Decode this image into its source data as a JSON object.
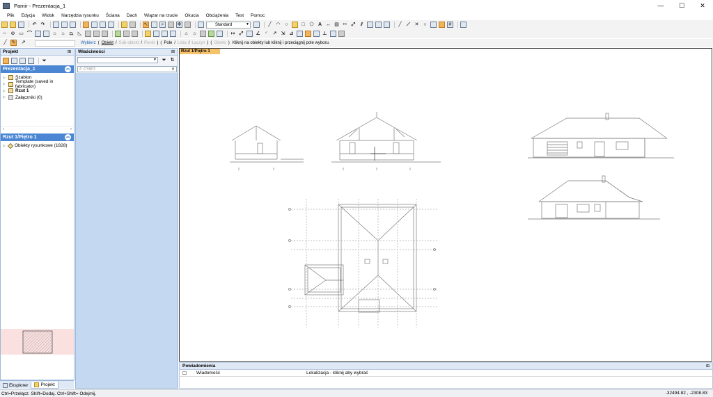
{
  "window": {
    "title": "Pamir - Prezentacja_1",
    "min": "—",
    "max": "☐",
    "close": "✕"
  },
  "menu": [
    "Plik",
    "Edycja",
    "Widok",
    "Narzędzia rysunku",
    "Ściana",
    "Dach",
    "Wiązar na rzucie",
    "Okucia",
    "Obciążenia",
    "Test",
    "Pomoc"
  ],
  "toolbar": {
    "style_combo": "Standard"
  },
  "selection_bar": {
    "cmd_select": "Wybierz",
    "opt_object": "Obiekt",
    "opt_sub_object": "Sub-obiekt",
    "opt_point": "Punkt",
    "opt_field": "Pole",
    "opt_line": "Linia",
    "opt_edge": "Łączyn",
    "opt_extra": "Obiekt",
    "hint": "Kliknij na obiekty lub kliknij i przeciągnij pole wyboru."
  },
  "project_panel": {
    "header": "Projekt",
    "section_title": "Prezentacja_1",
    "items": [
      {
        "label": "Szablon",
        "bold": false
      },
      {
        "label": "Template (saved in fabricator)",
        "bold": false
      },
      {
        "label": "Rzut 1",
        "bold": true
      },
      {
        "label": "Załączniki (0)",
        "bold": false
      }
    ],
    "floor_title": "Rzut 1/Piętro 1",
    "floor_items": [
      {
        "label": "Obiekty rysunkowe (1828)"
      }
    ]
  },
  "properties_panel": {
    "header": "Właściwości",
    "search_placeholder": "Znajdź"
  },
  "canvas": {
    "tab_label": "Rzut 1/Piętro 1"
  },
  "notifications": {
    "header": "Powiadomienia",
    "col_message": "Wiadomość",
    "col_location": "Lokalizacja - kliknij aby wybrać"
  },
  "bottom_tabs": {
    "explorer": "Eksplorer",
    "project": "Projekt"
  },
  "status": {
    "hint": "Ctrl=Przełącz. Shift=Dodaj. Ctrl+Shift= Odejmij.",
    "coords": "-32494.82 , -2308.83"
  },
  "colors": {
    "accent_blue": "#4a86d3",
    "panel_blue": "#dfe8f5",
    "canvas_tab": "#f5c26b",
    "highlight_pink": "#fbe0e0"
  }
}
